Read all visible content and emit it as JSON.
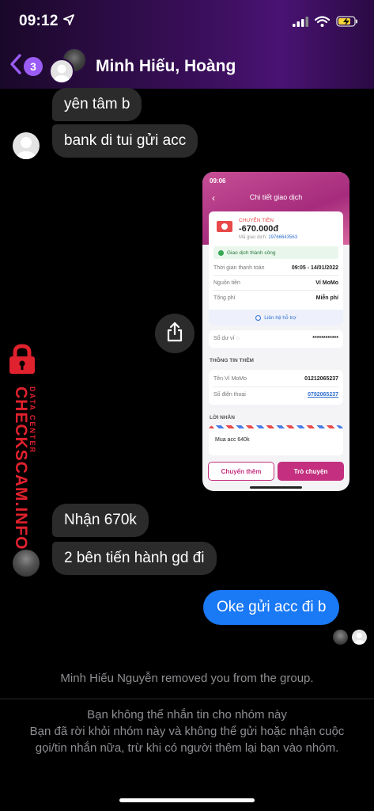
{
  "status_bar": {
    "time": "09:12",
    "icons": [
      "location-arrow-icon",
      "cellular-signal-icon",
      "wifi-icon",
      "battery-charging-icon"
    ]
  },
  "header": {
    "back_badge_count": "3",
    "title": "Minh Hiếu, Hoàng",
    "accent": "#9b5cf6"
  },
  "messages": [
    {
      "id": "m1",
      "sender": "other",
      "text": "yên tâm b"
    },
    {
      "id": "m2",
      "sender": "other",
      "text": "bank di tui gửi acc"
    },
    {
      "id": "m3",
      "sender": "other",
      "text": "Nhận 670k"
    },
    {
      "id": "m4",
      "sender": "other",
      "text": "2 bên tiến hành gd đi"
    },
    {
      "id": "m5",
      "sender": "me",
      "text": "Oke gửi acc đi b"
    }
  ],
  "shared_screenshot": {
    "time": "09:06",
    "title": "Chi tiết giao dịch",
    "transfer_label": "CHUYỂN TIỀN",
    "amount": "-670.000đ",
    "tx_code_label": "Mã giao dịch:",
    "tx_code": "19766643563",
    "status": "Giao dịch thành công",
    "rows": [
      {
        "label": "Thời gian thanh toán",
        "value": "09:05 - 14/01/2022"
      },
      {
        "label": "Nguồn tiền",
        "value": "Ví MoMo"
      },
      {
        "label": "Tổng phí",
        "value": "Miễn phí"
      }
    ],
    "support_link": "Liên hệ hỗ trợ",
    "balance_label": "Số dư ví",
    "balance_value": "************",
    "more_info_heading": "THÔNG TIN THÊM",
    "wallet_name_label": "Tên Ví MoMo",
    "wallet_name_value": "01212065237",
    "phone_label": "Số điện thoại",
    "phone_value": "0792065237",
    "message_heading": "LỜI NHẮN",
    "message_text": "Mua acc 640k",
    "btn_transfer_more": "Chuyển thêm",
    "btn_chat": "Trò chuyện",
    "brand_color": "#c4307f"
  },
  "watermark": {
    "main": "CHECKSCAM.INFO",
    "sub": "DATA CENTER",
    "color": "#e0212e"
  },
  "system_message": "Minh Hiếu Nguyễn removed you from the group.",
  "blocked": {
    "title": "Bạn không thể nhắn tin cho nhóm này",
    "description": "Bạn đã rời khỏi nhóm này và không thể gửi hoặc nhận cuộc gọi/tin nhắn nữa, trừ khi có người thêm lại bạn vào nhóm."
  }
}
